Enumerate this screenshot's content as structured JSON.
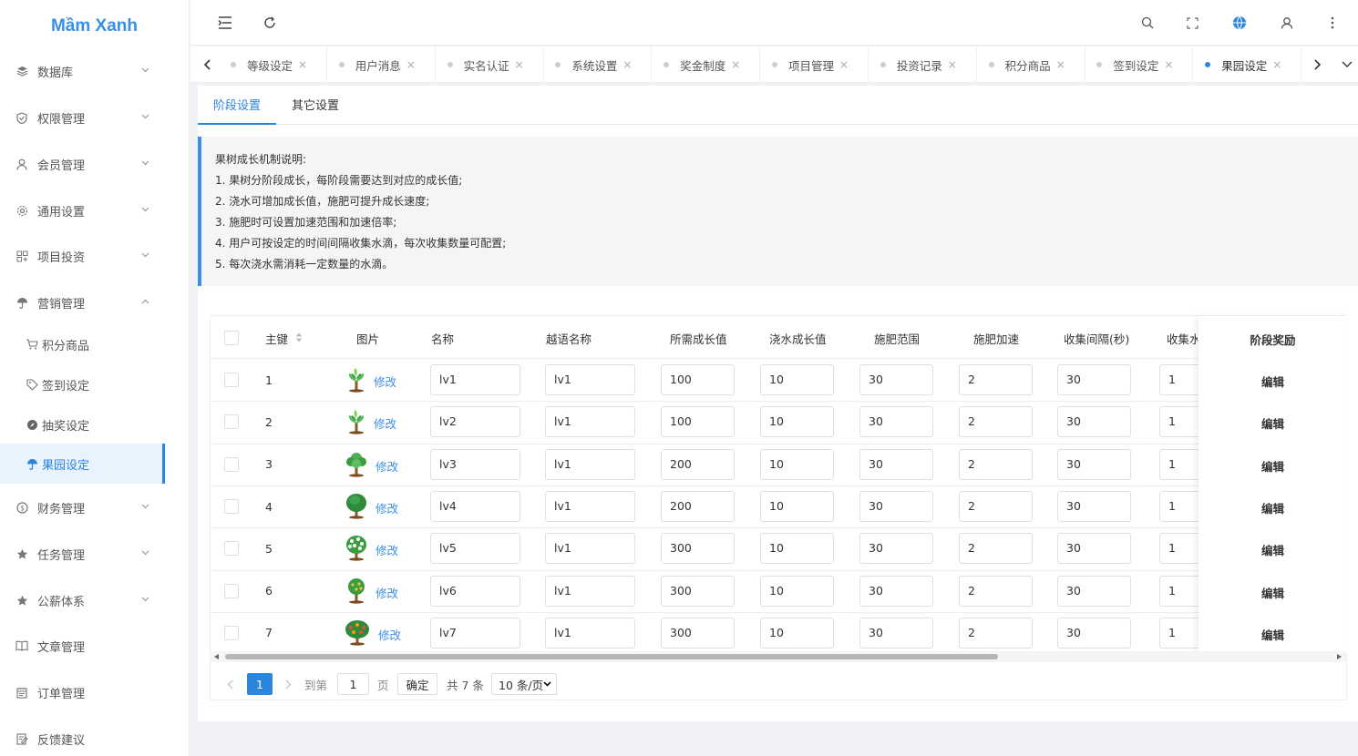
{
  "app": {
    "brand": "Mầm Xanh"
  },
  "sidebar": {
    "items": [
      {
        "label": "数据库",
        "icon": "database-icon",
        "has_children": true,
        "expanded": false
      },
      {
        "label": "权限管理",
        "icon": "shield-icon",
        "has_children": true,
        "expanded": false
      },
      {
        "label": "会员管理",
        "icon": "user-icon",
        "has_children": true,
        "expanded": false
      },
      {
        "label": "通用设置",
        "icon": "gear-icon",
        "has_children": true,
        "expanded": false
      },
      {
        "label": "项目投资",
        "icon": "grid-icon",
        "has_children": true,
        "expanded": false
      },
      {
        "label": "营销管理",
        "icon": "umbrella-icon",
        "has_children": true,
        "expanded": true
      },
      {
        "label": "财务管理",
        "icon": "coin-icon",
        "has_children": true,
        "expanded": false
      },
      {
        "label": "任务管理",
        "icon": "star-icon",
        "has_children": true,
        "expanded": false
      },
      {
        "label": "公薪体系",
        "icon": "star-icon",
        "has_children": true,
        "expanded": false
      },
      {
        "label": "文章管理",
        "icon": "book-icon",
        "has_children": false
      },
      {
        "label": "订单管理",
        "icon": "calendar-icon",
        "has_children": false
      },
      {
        "label": "反馈建议",
        "icon": "edit-icon",
        "has_children": false
      }
    ],
    "marketing_children": [
      {
        "label": "积分商品",
        "icon": "cart-icon"
      },
      {
        "label": "签到设定",
        "icon": "tag-icon"
      },
      {
        "label": "抽奖设定",
        "icon": "compass-icon"
      },
      {
        "label": "果园设定",
        "icon": "umbrella-icon",
        "active": true
      }
    ]
  },
  "header": {
    "icons": [
      "collapse-menu-icon",
      "refresh-icon",
      "search-icon",
      "fullscreen-icon",
      "globe-icon",
      "user-icon",
      "more-vertical-icon"
    ]
  },
  "tabs": {
    "items": [
      {
        "label": "等级设定"
      },
      {
        "label": "用户消息"
      },
      {
        "label": "实名认证"
      },
      {
        "label": "系统设置"
      },
      {
        "label": "奖金制度"
      },
      {
        "label": "项目管理"
      },
      {
        "label": "投资记录"
      },
      {
        "label": "积分商品"
      },
      {
        "label": "签到设定"
      },
      {
        "label": "果园设定",
        "active": true
      }
    ],
    "close_glyph": "×"
  },
  "subtabs": {
    "stage": "阶段设置",
    "other": "其它设置"
  },
  "notice": {
    "title": "果树成长机制说明:",
    "lines": [
      "1. 果树分阶段成长，每阶段需要达到对应的成长值;",
      "2. 浇水可增加成长值，施肥可提升成长速度;",
      "3. 施肥时可设置加速范围和加速倍率;",
      "4. 用户可按设定的时间间隔收集水滴，每次收集数量可配置;",
      "5. 每次浇水需消耗一定数量的水滴。"
    ]
  },
  "table": {
    "headers": {
      "id": "主键",
      "image": "图片",
      "name": "名称",
      "vn_name": "越语名称",
      "growth_needed": "所需成长值",
      "water_growth": "浇水成长值",
      "fert_range": "施肥范围",
      "fert_speed": "施肥加速",
      "collect_interval": "收集间隔(秒)",
      "collect_amount": "收集水",
      "reward": "阶段奖励"
    },
    "modify_label": "修改",
    "reward_action": "编辑",
    "rows": [
      {
        "id": "1",
        "name": "lv1",
        "vn_name": "lv1",
        "growth_needed": "100",
        "water_growth": "10",
        "fert_range": "30",
        "fert_speed": "2",
        "collect_interval": "30",
        "collect_amount": "1",
        "tree": "sapling"
      },
      {
        "id": "2",
        "name": "lv2",
        "vn_name": "lv1",
        "growth_needed": "100",
        "water_growth": "10",
        "fert_range": "30",
        "fert_speed": "2",
        "collect_interval": "30",
        "collect_amount": "1",
        "tree": "sapling"
      },
      {
        "id": "3",
        "name": "lv3",
        "vn_name": "lv1",
        "growth_needed": "200",
        "water_growth": "10",
        "fert_range": "30",
        "fert_speed": "2",
        "collect_interval": "30",
        "collect_amount": "1",
        "tree": "young"
      },
      {
        "id": "4",
        "name": "lv4",
        "vn_name": "lv1",
        "growth_needed": "200",
        "water_growth": "10",
        "fert_range": "30",
        "fert_speed": "2",
        "collect_interval": "30",
        "collect_amount": "1",
        "tree": "tree"
      },
      {
        "id": "5",
        "name": "lv5",
        "vn_name": "lv1",
        "growth_needed": "300",
        "water_growth": "10",
        "fert_range": "30",
        "fert_speed": "2",
        "collect_interval": "30",
        "collect_amount": "1",
        "tree": "blossom"
      },
      {
        "id": "6",
        "name": "lv6",
        "vn_name": "lv1",
        "growth_needed": "300",
        "water_growth": "10",
        "fert_range": "30",
        "fert_speed": "2",
        "collect_interval": "30",
        "collect_amount": "1",
        "tree": "young-fruit"
      },
      {
        "id": "7",
        "name": "lv7",
        "vn_name": "lv1",
        "growth_needed": "300",
        "water_growth": "10",
        "fert_range": "30",
        "fert_speed": "2",
        "collect_interval": "30",
        "collect_amount": "1",
        "tree": "fruit"
      }
    ]
  },
  "pagination": {
    "current_page": "1",
    "goto_label": "到第",
    "goto_value": "1",
    "page_unit": "页",
    "confirm": "确定",
    "total": "共 7 条",
    "page_size": "10 条/页"
  },
  "colors": {
    "accent": "#2b86e0",
    "brand": "#3a8ee6"
  }
}
